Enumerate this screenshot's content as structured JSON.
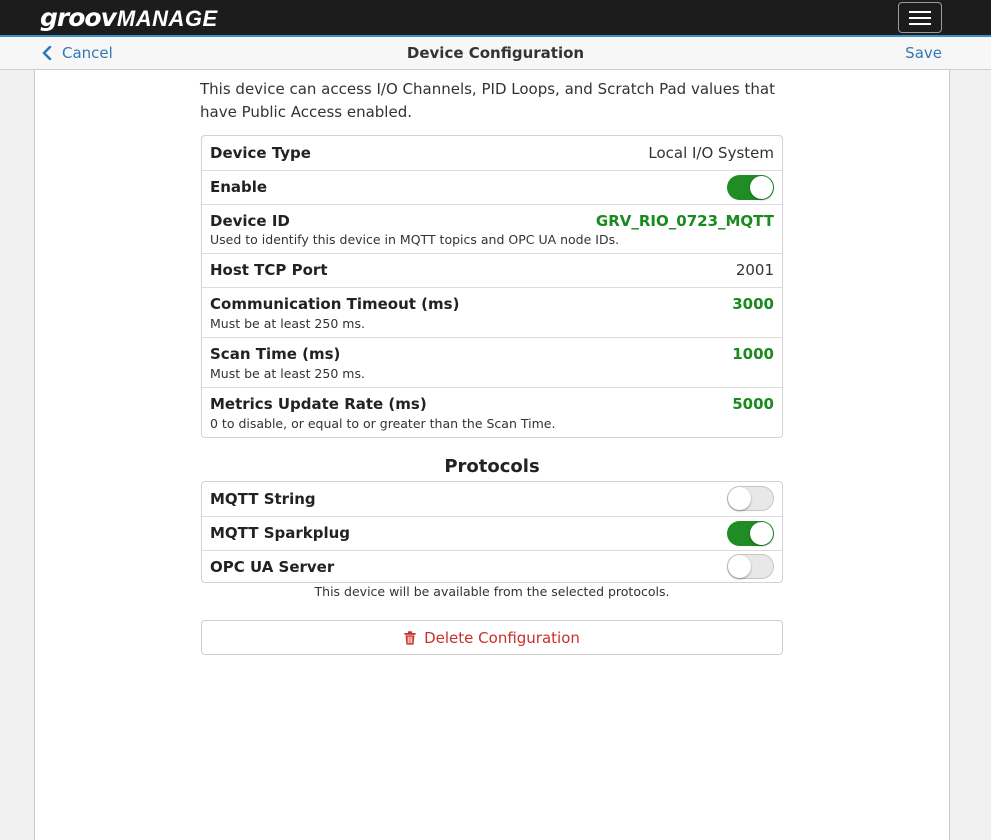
{
  "app": {
    "logo_groov": "groov",
    "logo_manage": "MANAGE"
  },
  "nav": {
    "cancel_label": "Cancel",
    "title": "Device Configuration",
    "save_label": "Save"
  },
  "intro_text": "This device can access I/O Channels, PID Loops, and Scratch Pad values that have Public Access enabled.",
  "settings": {
    "device_type": {
      "label": "Device Type",
      "value": "Local I/O System"
    },
    "enable": {
      "label": "Enable",
      "on": true
    },
    "device_id": {
      "label": "Device ID",
      "value": "GRV_RIO_0723_MQTT",
      "help": "Used to identify this device in MQTT topics and OPC UA node IDs."
    },
    "host_tcp_port": {
      "label": "Host TCP Port",
      "value": "2001"
    },
    "comm_timeout": {
      "label": "Communication Timeout (ms)",
      "value": "3000",
      "help": "Must be at least 250 ms."
    },
    "scan_time": {
      "label": "Scan Time (ms)",
      "value": "1000",
      "help": "Must be at least 250 ms."
    },
    "metrics_rate": {
      "label": "Metrics Update Rate (ms)",
      "value": "5000",
      "help": "0 to disable, or equal to or greater than the Scan Time."
    }
  },
  "protocols": {
    "title": "Protocols",
    "items": [
      {
        "label": "MQTT String",
        "on": false
      },
      {
        "label": "MQTT Sparkplug",
        "on": true
      },
      {
        "label": "OPC UA Server",
        "on": false
      }
    ],
    "note": "This device will be available from the selected protocols."
  },
  "delete_label": "Delete Configuration",
  "colors": {
    "accent_blue": "#3178b8",
    "toggle_green": "#1f8c24",
    "value_green": "#188a1e",
    "danger_red": "#c9302c"
  }
}
